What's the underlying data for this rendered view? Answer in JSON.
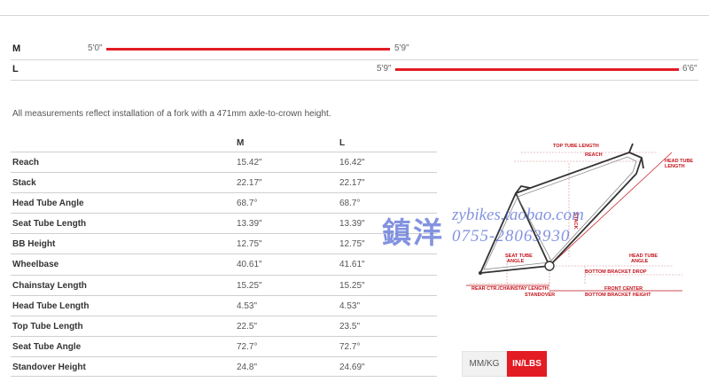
{
  "size_ranges": [
    {
      "size": "M",
      "from": "5'0\"",
      "to": "5'9\""
    },
    {
      "size": "L",
      "from": "5'9\"",
      "to": "6'6\""
    }
  ],
  "note": "All measurements reflect installation of a fork with a 471mm axle-to-crown height.",
  "table": {
    "headers": [
      "",
      "M",
      "L"
    ],
    "rows": [
      {
        "name": "Reach",
        "m": "15.42\"",
        "l": "16.42\""
      },
      {
        "name": "Stack",
        "m": "22.17\"",
        "l": "22.17\""
      },
      {
        "name": "Head Tube Angle",
        "m": "68.7°",
        "l": "68.7°"
      },
      {
        "name": "Seat Tube Length",
        "m": "13.39\"",
        "l": "13.39\""
      },
      {
        "name": "BB Height",
        "m": "12.75\"",
        "l": "12.75\""
      },
      {
        "name": "Wheelbase",
        "m": "40.61\"",
        "l": "41.61\""
      },
      {
        "name": "Chainstay Length",
        "m": "15.25\"",
        "l": "15.25\""
      },
      {
        "name": "Head Tube Length",
        "m": "4.53\"",
        "l": "4.53\""
      },
      {
        "name": "Top Tube Length",
        "m": "22.5\"",
        "l": "23.5\""
      },
      {
        "name": "Seat Tube Angle",
        "m": "72.7°",
        "l": "72.7°"
      },
      {
        "name": "Standover Height",
        "m": "24.8\"",
        "l": "24.69\""
      }
    ]
  },
  "diagram": {
    "labels": {
      "top_tube_length": "TOP TUBE LENGTH",
      "reach": "REACH",
      "head_tube_length_1": "HEAD TUBE",
      "head_tube_length_2": "LENGTH",
      "stack": "STACK",
      "seat_tube_angle_1": "SEAT TUBE",
      "seat_tube_angle_2": "ANGLE",
      "head_tube_angle_1": "HEAD TUBE",
      "head_tube_angle_2": "ANGLE",
      "bb_drop": "BOTTOM BRACKET DROP",
      "rear_center": "REAR CTR./CHAINSTAY LENGTH",
      "front_center": "FRONT CENTER",
      "standover": "STANDOVER",
      "bb_height": "BOTTOM BRACKET HEIGHT"
    }
  },
  "units": {
    "metric": "MM/KG",
    "imperial": "IN/LBS",
    "active": "imperial"
  },
  "watermark": {
    "chinese": "鎮洋",
    "site": "zybikes.taobao.com",
    "phone": "0755-28063930"
  },
  "colors": {
    "accent": "#e31b23",
    "watermark": "#3750cd"
  }
}
